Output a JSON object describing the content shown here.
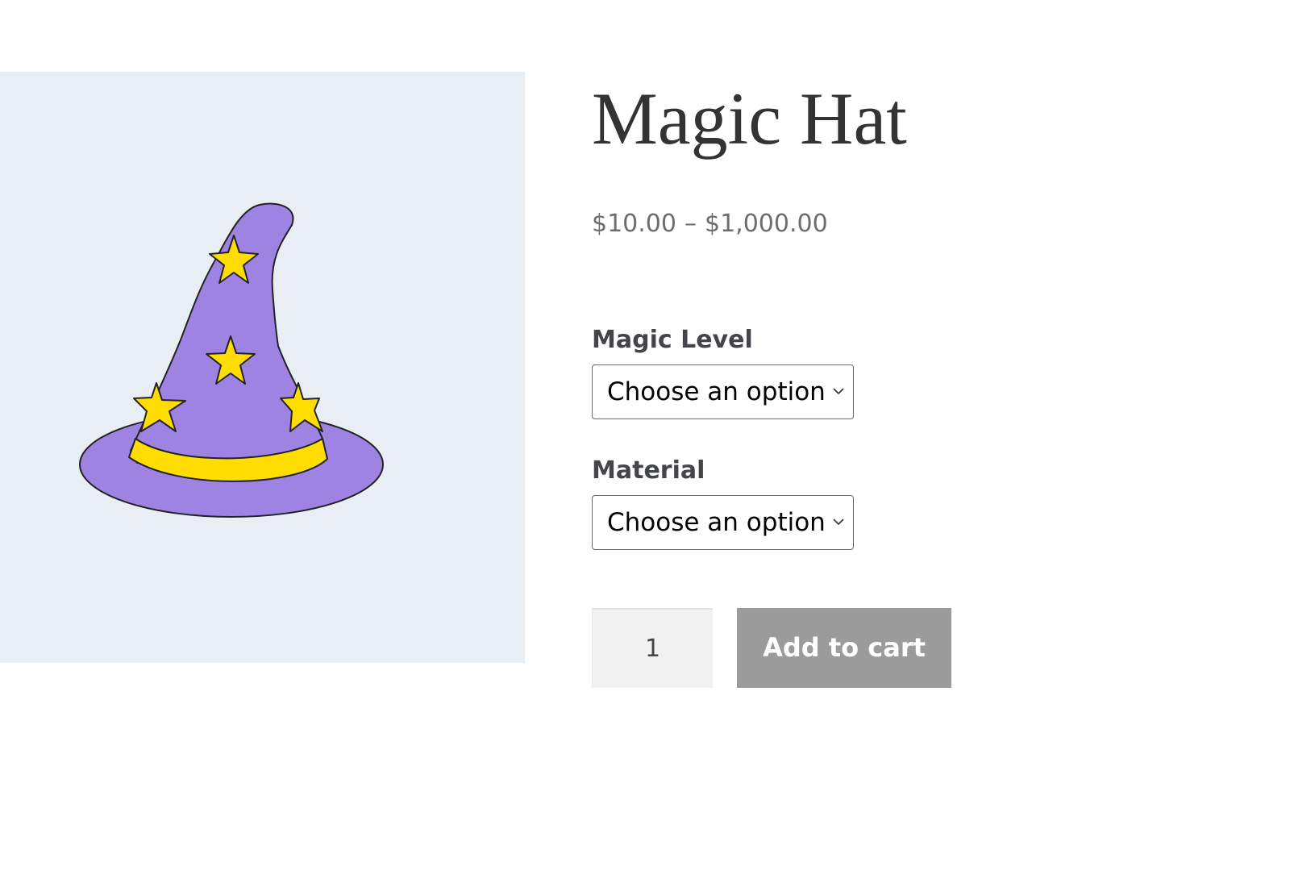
{
  "product": {
    "title": "Magic Hat",
    "image_alt": "wizard-hat-image",
    "price_min": "$10.00",
    "price_separator": "–",
    "price_max": "$1,000.00"
  },
  "variations": [
    {
      "label": "Magic Level",
      "selected": "Choose an option"
    },
    {
      "label": "Material",
      "selected": "Choose an option"
    }
  ],
  "cart": {
    "quantity": "1",
    "add_to_cart_label": "Add to cart"
  },
  "colors": {
    "image_background": "#e8eef3",
    "hat_purple": "#9f83e2",
    "hat_yellow": "#ffdd00",
    "button_disabled": "#9b9b9b"
  }
}
